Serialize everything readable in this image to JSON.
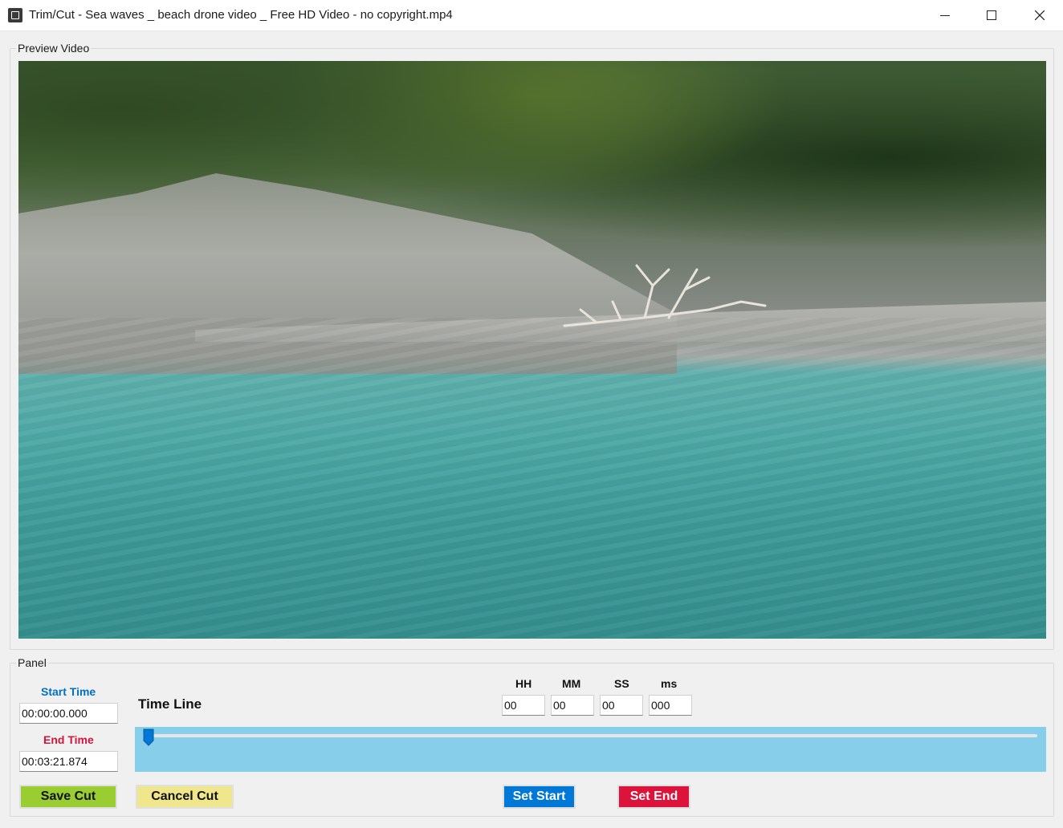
{
  "window": {
    "title": "Trim/Cut - Sea waves _ beach drone video _ Free HD Video - no copyright.mp4",
    "controls": [
      "minimize-icon",
      "maximize-icon",
      "close-icon"
    ]
  },
  "preview": {
    "group_label": "Preview Video"
  },
  "panel": {
    "group_label": "Panel",
    "start_time_label": "Start Time",
    "start_time_value": "00:00:00.000",
    "end_time_label": "End Time",
    "end_time_value": "00:03:21.874",
    "timeline_label": "Time Line",
    "hh_label": "HH",
    "mm_label": "MM",
    "ss_label": "SS",
    "ms_label": "ms",
    "hh_value": "00",
    "mm_value": "00",
    "ss_value": "00",
    "ms_value": "000",
    "timeline_position": 0.0,
    "save_cut": "Save Cut",
    "cancel_cut": "Cancel Cut",
    "set_start": "Set Start",
    "set_end": "Set End"
  },
  "colors": {
    "start_label": "#0070c0",
    "end_label": "#d4143c",
    "timeline_bg": "#87ceeb",
    "save_btn": "#9acd32",
    "cancel_btn": "#f0e68c",
    "set_start_btn": "#0078d7",
    "set_end_btn": "#dc143c"
  }
}
